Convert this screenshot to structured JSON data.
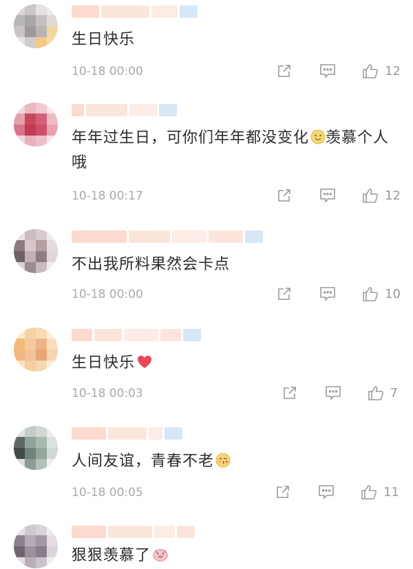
{
  "comments": [
    {
      "text": "生日快乐",
      "time": "10-18 00:00",
      "likes": "12"
    },
    {
      "text": "年年过生日，可你们年年都没变化",
      "text_after": "羡慕个人哦",
      "time": "10-18 00:17",
      "likes": "12"
    },
    {
      "text": "不出我所料果然会卡点",
      "time": "10-18 00:00",
      "likes": "10"
    },
    {
      "text": "生日快乐",
      "time": "10-18 00:03",
      "likes": "7"
    },
    {
      "text": "人间友谊，青春不老",
      "time": "10-18 00:05",
      "likes": "11"
    },
    {
      "text": "狠狠羡慕了"
    }
  ],
  "icons": {
    "share": "share-icon",
    "reply": "comment-icon",
    "like": "thumbs-up-icon",
    "smile": "smile-emoji-icon",
    "heart": "heart-emoji-icon",
    "kiss": "kiss-emoji-icon",
    "pig": "pig-emoji-icon"
  },
  "colors": {
    "meta_text": "#a9a9a9",
    "icon_gray": "#9a9a9a",
    "heart_red": "#e8485a"
  }
}
